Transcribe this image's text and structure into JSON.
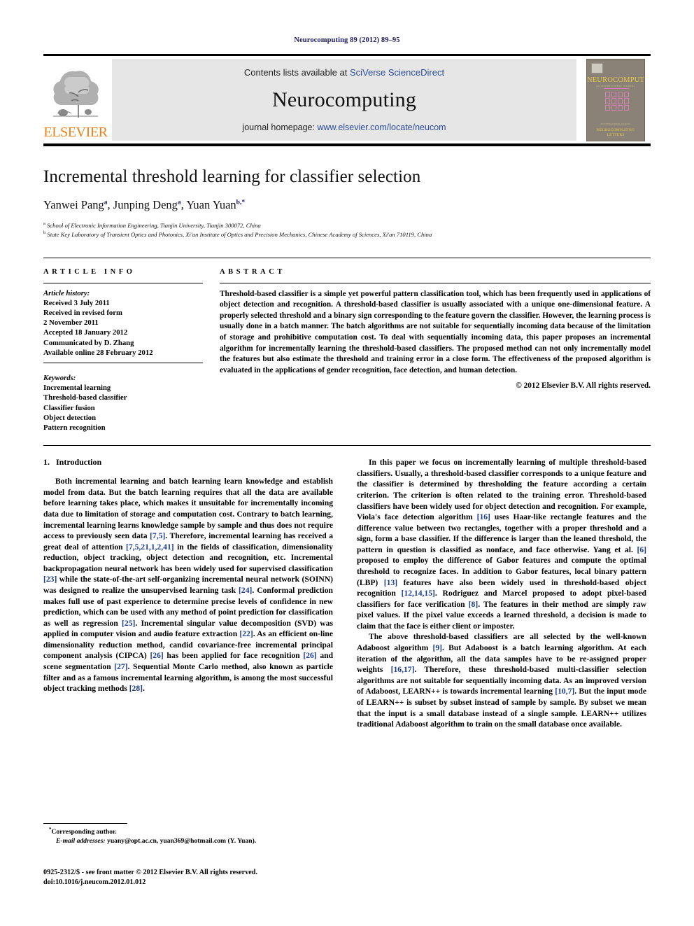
{
  "running_head": "Neurocomputing 89 (2012) 89–95",
  "masthead": {
    "publisher_logo_label": "ELSEVIER",
    "contents_prefix": "Contents lists available at ",
    "contents_link": "SciVerse ScienceDirect",
    "journal_name": "Neurocomputing",
    "homepage_prefix": "journal homepage: ",
    "homepage_link": "www.elsevier.com/locate/neucom",
    "cover": {
      "title": "NEUROCOMPUTING",
      "subtitle": "AN INTERNATIONAL JOURNAL",
      "footer_small": "AN INTERNATIONAL JOURNAL",
      "footer_line1": "NEUROCOMPUTING",
      "footer_line2": "LETTERS"
    }
  },
  "article": {
    "title": "Incremental threshold learning for classifier selection",
    "authors_html": "Yanwei Pang, Junping Deng, Yuan Yuan",
    "author_list": [
      {
        "name": "Yanwei Pang",
        "marker": "a"
      },
      {
        "name": "Junping Deng",
        "marker": "a"
      },
      {
        "name": "Yuan Yuan",
        "marker": "b,*"
      }
    ],
    "affiliations": [
      {
        "marker": "a",
        "text": "School of Electronic Information Engineering, Tianjin University, Tianjin 300072, China"
      },
      {
        "marker": "b",
        "text": "State Key Laboratory of Transient Optics and Photonics, Xi'an Institute of Optics and Precision Mechanics, Chinese Academy of Sciences, Xi'an 710119, China"
      }
    ]
  },
  "article_info": {
    "heading": "ARTICLE INFO",
    "history_title": "Article history:",
    "history_lines": [
      "Received 3 July 2011",
      "Received in revised form",
      "2 November 2011",
      "Accepted 18 January 2012",
      "Communicated by D. Zhang",
      "Available online 28 February 2012"
    ],
    "keywords_title": "Keywords:",
    "keywords": [
      "Incremental learning",
      "Threshold-based classifier",
      "Classifier fusion",
      "Object detection",
      "Pattern recognition"
    ]
  },
  "abstract": {
    "heading": "ABSTRACT",
    "body": "Threshold-based classifier is a simple yet powerful pattern classification tool, which has been frequently used in applications of object detection and recognition. A threshold-based classifier is usually associated with a unique one-dimensional feature. A properly selected threshold and a binary sign corresponding to the feature govern the classifier. However, the learning process is usually done in a batch manner. The batch algorithms are not suitable for sequentially incoming data because of the limitation of storage and prohibitive computation cost. To deal with sequentially incoming data, this paper proposes an incremental algorithm for incrementally learning the threshold-based classifiers. The proposed method can not only incrementally model the features but also estimate the threshold and training error in a close form. The effectiveness of the proposed algorithm is evaluated in the applications of gender recognition, face detection, and human detection.",
    "copyright": "© 2012 Elsevier B.V. All rights reserved."
  },
  "introduction": {
    "number": "1.",
    "heading": "Introduction",
    "left_paragraphs": [
      "Both incremental learning and batch learning learn knowledge and establish model from data. But the batch learning requires that all the data are available before learning takes place, which makes it unsuitable for incrementally incoming data due to limitation of storage and computation cost. Contrary to batch learning, incremental learning learns knowledge sample by sample and thus does not require access to previously seen data [7,5]. Therefore, incremental learning has received a great deal of attention [7,5,21,1,2,41] in the fields of classification, dimensionality reduction, object tracking, object detection and recognition, etc. Incremental backpropagation neural network has been widely used for supervised classification [23] while the state-of-the-art self-organizing incremental neural network (SOINN) was designed to realize the unsupervised learning task [24]. Conformal prediction makes full use of past experience to determine precise levels of confidence in new prediction, which can be used with any method of point prediction for classification as well as regression [25]. Incremental singular value decomposition (SVD) was applied in computer vision and audio feature extraction [22]. As an efficient on-line dimensionality reduction method, candid covariance-free incremental principal component analysis (CIPCA) [26] has been applied for face recognition [26] and scene segmentation [27]. Sequential Monte Carlo method, also known as particle filter and as a famous incremental learning algorithm, is among the most successful object tracking methods [28]."
    ],
    "right_paragraphs": [
      "In this paper we focus on incrementally learning of multiple threshold-based classifiers. Usually, a threshold-based classifier corresponds to a unique feature and the classifier is determined by thresholding the feature according a certain criterion. The criterion is often related to the training error. Threshold-based classifiers have been widely used for object detection and recognition. For example, Viola's face detection algorithm [16] uses Haar-like rectangle features and the difference value between two rectangles, together with a proper threshold and a sign, form a base classifier. If the difference is larger than the leaned threshold, the pattern in question is classified as nonface, and face otherwise. Yang et al. [6] proposed to employ the difference of Gabor features and compute the optimal threshold to recognize faces. In addition to Gabor features, local binary pattern (LBP) [13] features have also been widely used in threshold-based object recognition [12,14,15]. Rodriguez and Marcel proposed to adopt pixel-based classifiers for face verification [8]. The features in their method are simply raw pixel values. If the pixel value exceeds a learned threshold, a decision is made to claim that the face is either client or imposter.",
      "The above threshold-based classifiers are all selected by the well-known Adaboost algorithm [9]. But Adaboost is a batch learning algorithm. At each iteration of the algorithm, all the data samples have to be re-assigned proper weights [16,17]. Therefore, these threshold-based multi-classifier selection algorithms are not suitable for sequentially incoming data. As an improved version of Adaboost, LEARN++ is towards incremental learning [10,7]. But the input mode of LEARN++ is subset by subset instead of sample by sample. By subset we mean that the input is a small database instead of a single sample. LEARN++ utilizes traditional Adaboost algorithm to train on the small database once available."
    ]
  },
  "footnote": {
    "corresponding_marker": "*",
    "corresponding_text": "Corresponding author.",
    "email_label": "E-mail addresses:",
    "email_text": " yuany@opt.ac.cn, yuan369@hotmail.com (Y. Yuan)."
  },
  "imprint": {
    "line1": "0925-2312/$ - see front matter © 2012 Elsevier B.V. All rights reserved.",
    "line2": "doi:10.1016/j.neucom.2012.01.012"
  },
  "colors": {
    "link": "#2a4b9b",
    "reference": "#1a3a8f",
    "elsevier_orange": "#f07f13",
    "masthead_gray": "#e6e6e6",
    "runhead_navy": "#1a1a5e",
    "cover_bg": "#8a8276",
    "cover_yellow": "#e8c64a",
    "cover_pink": "#d87fb4"
  }
}
